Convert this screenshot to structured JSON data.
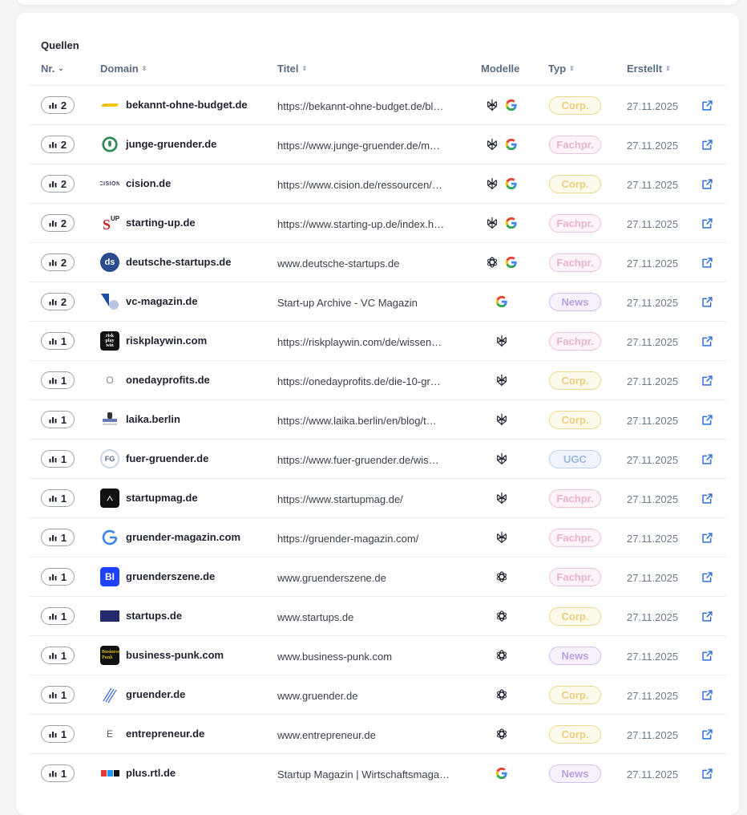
{
  "section_title": "Quellen",
  "headers": {
    "nr": "Nr.",
    "domain": "Domain",
    "titel": "Titel",
    "modelle": "Modelle",
    "typ": "Typ",
    "erstellt": "Erstellt"
  },
  "colors": {
    "accent": "#2f6fe0",
    "text_muted": "#5b6b86",
    "border": "#ececf1"
  },
  "rows": [
    {
      "count": "2",
      "favicon": "bekannt-logo",
      "domain": "bekannt-ohne-budget.de",
      "title": "https://bekannt-ohne-budget.de/bl…",
      "models": [
        "perplexity",
        "google"
      ],
      "type": "Corp.",
      "created": "27.11.2025"
    },
    {
      "count": "2",
      "favicon": "junge-gruender-logo",
      "domain": "junge-gruender.de",
      "title": "https://www.junge-gruender.de/m…",
      "models": [
        "perplexity",
        "google"
      ],
      "type": "Fachpr.",
      "created": "27.11.2025"
    },
    {
      "count": "2",
      "favicon": "cision-logo",
      "domain": "cision.de",
      "title": "https://www.cision.de/ressourcen/…",
      "models": [
        "perplexity",
        "google"
      ],
      "type": "Corp.",
      "created": "27.11.2025"
    },
    {
      "count": "2",
      "favicon": "starting-up-logo",
      "domain": "starting-up.de",
      "title": "https://www.starting-up.de/index.h…",
      "models": [
        "perplexity",
        "google"
      ],
      "type": "Fachpr.",
      "created": "27.11.2025"
    },
    {
      "count": "2",
      "favicon": "deutsche-startups-logo",
      "domain": "deutsche-startups.de",
      "title": "www.deutsche-startups.de",
      "models": [
        "openai",
        "google"
      ],
      "type": "Fachpr.",
      "created": "27.11.2025"
    },
    {
      "count": "2",
      "favicon": "vc-magazin-logo",
      "domain": "vc-magazin.de",
      "title": "Start-up Archive - VC Magazin",
      "models": [
        "google"
      ],
      "type": "News",
      "created": "27.11.2025"
    },
    {
      "count": "1",
      "favicon": "riskplaywin-logo",
      "domain": "riskplaywin.com",
      "title": "https://riskplaywin.com/de/wissen…",
      "models": [
        "perplexity"
      ],
      "type": "Fachpr.",
      "created": "27.11.2025"
    },
    {
      "count": "1",
      "favicon": "onedayprofits-logo",
      "domain": "onedayprofits.de",
      "title": "https://onedayprofits.de/die-10-gr…",
      "models": [
        "perplexity"
      ],
      "type": "Corp.",
      "created": "27.11.2025"
    },
    {
      "count": "1",
      "favicon": "laika-logo",
      "domain": "laika.berlin",
      "title": "https://www.laika.berlin/en/blog/t…",
      "models": [
        "perplexity"
      ],
      "type": "Corp.",
      "created": "27.11.2025"
    },
    {
      "count": "1",
      "favicon": "fuer-gruender-logo",
      "domain": "fuer-gruender.de",
      "title": "https://www.fuer-gruender.de/wis…",
      "models": [
        "perplexity"
      ],
      "type": "UGC",
      "created": "27.11.2025"
    },
    {
      "count": "1",
      "favicon": "startupmag-logo",
      "domain": "startupmag.de",
      "title": "https://www.startupmag.de/",
      "models": [
        "perplexity"
      ],
      "type": "Fachpr.",
      "created": "27.11.2025"
    },
    {
      "count": "1",
      "favicon": "gruender-magazin-logo",
      "domain": "gruender-magazin.com",
      "title": "https://gruender-magazin.com/",
      "models": [
        "perplexity"
      ],
      "type": "Fachpr.",
      "created": "27.11.2025"
    },
    {
      "count": "1",
      "favicon": "business-insider-logo",
      "domain": "gruenderszene.de",
      "title": "www.gruenderszene.de",
      "models": [
        "openai"
      ],
      "type": "Fachpr.",
      "created": "27.11.2025"
    },
    {
      "count": "1",
      "favicon": "startups-logo",
      "domain": "startups.de",
      "title": "www.startups.de",
      "models": [
        "openai"
      ],
      "type": "Corp.",
      "created": "27.11.2025"
    },
    {
      "count": "1",
      "favicon": "business-punk-logo",
      "domain": "business-punk.com",
      "title": "www.business-punk.com",
      "models": [
        "openai"
      ],
      "type": "News",
      "created": "27.11.2025"
    },
    {
      "count": "1",
      "favicon": "gruender-logo",
      "domain": "gruender.de",
      "title": "www.gruender.de",
      "models": [
        "openai"
      ],
      "type": "Corp.",
      "created": "27.11.2025"
    },
    {
      "count": "1",
      "favicon": "entrepreneur-logo",
      "domain": "entrepreneur.de",
      "title": "www.entrepreneur.de",
      "models": [
        "openai"
      ],
      "type": "Corp.",
      "created": "27.11.2025"
    },
    {
      "count": "1",
      "favicon": "rtl-logo",
      "domain": "plus.rtl.de",
      "title": "Startup Magazin | Wirtschaftsmaga…",
      "models": [
        "google"
      ],
      "type": "News",
      "created": "27.11.2025"
    }
  ]
}
